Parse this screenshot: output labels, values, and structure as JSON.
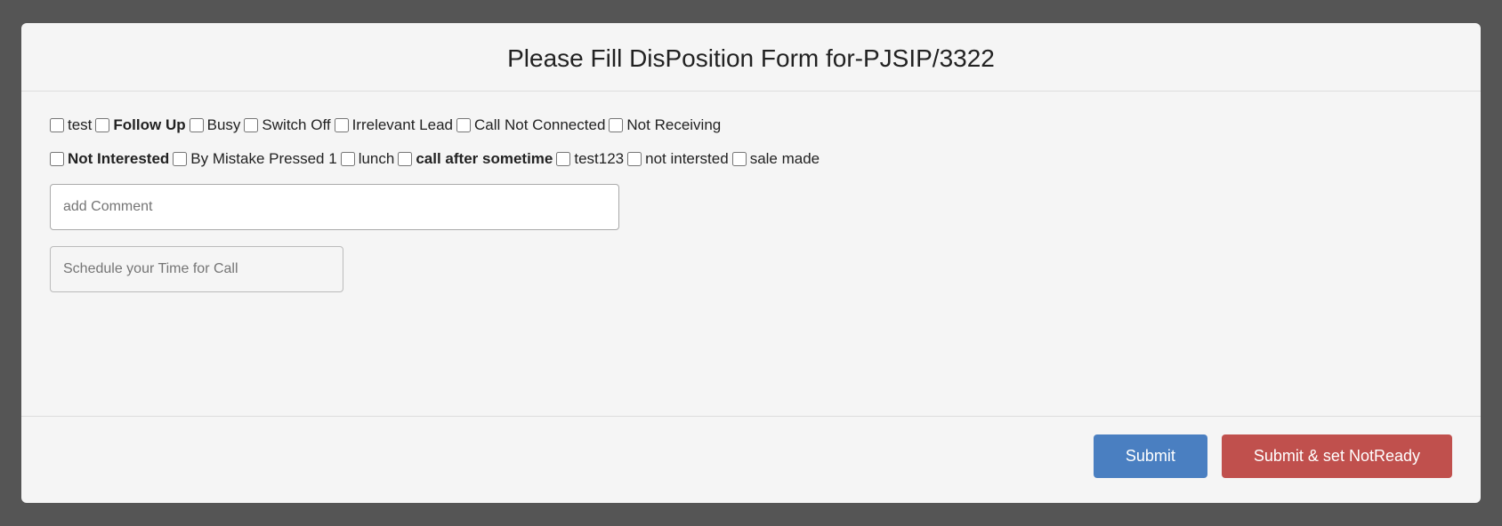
{
  "modal": {
    "title": "Please Fill DisPosition Form for-PJSIP/3322",
    "checkboxes_row1": [
      {
        "id": "cb_test",
        "label": "test",
        "bold": false
      },
      {
        "id": "cb_followup",
        "label": "Follow Up",
        "bold": true
      },
      {
        "id": "cb_busy",
        "label": "Busy",
        "bold": false
      },
      {
        "id": "cb_switchoff",
        "label": "Switch Off",
        "bold": false
      },
      {
        "id": "cb_irrelevant",
        "label": "Irrelevant Lead",
        "bold": false
      },
      {
        "id": "cb_callnotconnected",
        "label": "Call Not Connected",
        "bold": false
      },
      {
        "id": "cb_notreceiving",
        "label": "Not Receiving",
        "bold": false
      }
    ],
    "checkboxes_row2": [
      {
        "id": "cb_notinterested",
        "label": "Not Interested",
        "bold": true
      },
      {
        "id": "cb_bymistake",
        "label": "By Mistake Pressed 1",
        "bold": false
      },
      {
        "id": "cb_lunch",
        "label": "lunch",
        "bold": false
      },
      {
        "id": "cb_callafter",
        "label": "call after sometime",
        "bold": true
      },
      {
        "id": "cb_test123",
        "label": "test123",
        "bold": false
      },
      {
        "id": "cb_notintersted",
        "label": "not intersted",
        "bold": false
      },
      {
        "id": "cb_salemade",
        "label": "sale made",
        "bold": false
      }
    ],
    "comment_placeholder": "add Comment",
    "schedule_placeholder": "Schedule your Time for Call",
    "submit_label": "Submit",
    "submit_not_ready_label": "Submit & set NotReady"
  }
}
